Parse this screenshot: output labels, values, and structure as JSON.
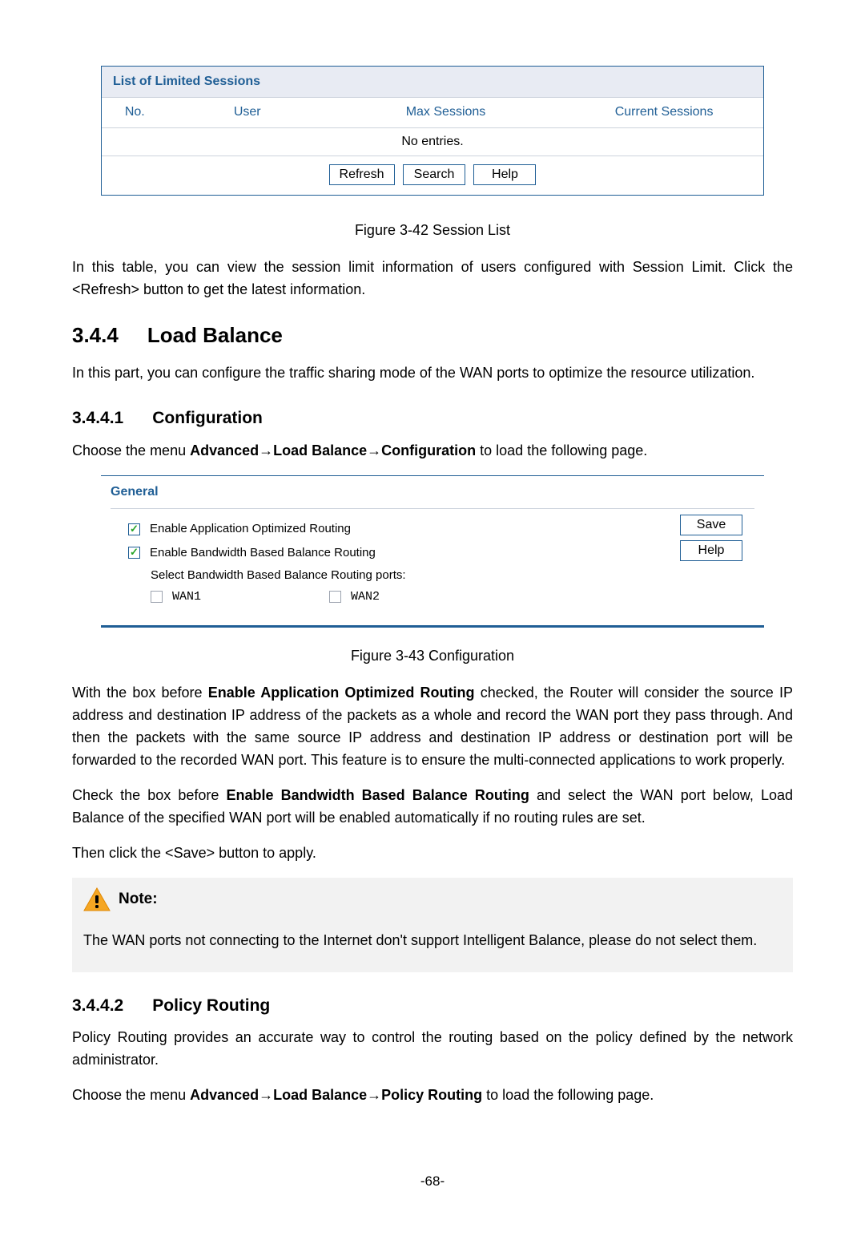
{
  "sessionList": {
    "title": "List of Limited Sessions",
    "headers": {
      "no": "No.",
      "user": "User",
      "max": "Max Sessions",
      "current": "Current Sessions"
    },
    "noEntries": "No entries.",
    "buttons": {
      "refresh": "Refresh",
      "search": "Search",
      "help": "Help"
    }
  },
  "caption1": "Figure 3-42 Session List",
  "para1": "In this table, you can view the session limit information of users configured with Session Limit. Click the <Refresh> button to get the latest information.",
  "h344_num": "3.4.4",
  "h344_text": "Load Balance",
  "para2": "In this part, you can configure the traffic sharing mode of the WAN ports to optimize the resource utilization.",
  "h3441_num": "3.4.4.1",
  "h3441_text": "Configuration",
  "para3_a": "Choose the menu ",
  "para3_b": "Advanced→Load Balance→Configuration",
  "para3_c": " to load the following page.",
  "general": {
    "title": "General",
    "opt1": "Enable Application Optimized Routing",
    "opt2": "Enable Bandwidth Based Balance Routing",
    "sub": "Select Bandwidth Based Balance Routing ports:",
    "wan1": "WAN1",
    "wan2": "WAN2",
    "save": "Save",
    "help": "Help"
  },
  "caption2": "Figure 3-43 Configuration",
  "para4_a": "With the box before ",
  "para4_b": "Enable Application Optimized Routing",
  "para4_c": " checked, the Router will consider the source IP address and destination IP address of the packets as a whole and record the WAN port they pass through. And then the packets with the same source IP address and destination IP address or destination port will be forwarded to the recorded WAN port. This feature is to ensure the multi-connected applications to work properly.",
  "para5_a": "Check the box before ",
  "para5_b": "Enable Bandwidth Based Balance Routing",
  "para5_c": " and select the WAN port below, Load Balance of the specified WAN port will be enabled automatically if no routing rules are set.",
  "para6": "Then click the <Save> button to apply.",
  "noteLabel": "Note:",
  "noteBody": "The WAN ports not connecting to the Internet don't support Intelligent Balance, please do not select them.",
  "h3442_num": "3.4.4.2",
  "h3442_text": "Policy Routing",
  "para7": "Policy Routing provides an accurate way to control the routing based on the policy defined by the network administrator.",
  "para8_a": "Choose the menu ",
  "para8_b": "Advanced→Load Balance→Policy Routing",
  "para8_c": " to load the following page.",
  "pageNumber": "-68-"
}
